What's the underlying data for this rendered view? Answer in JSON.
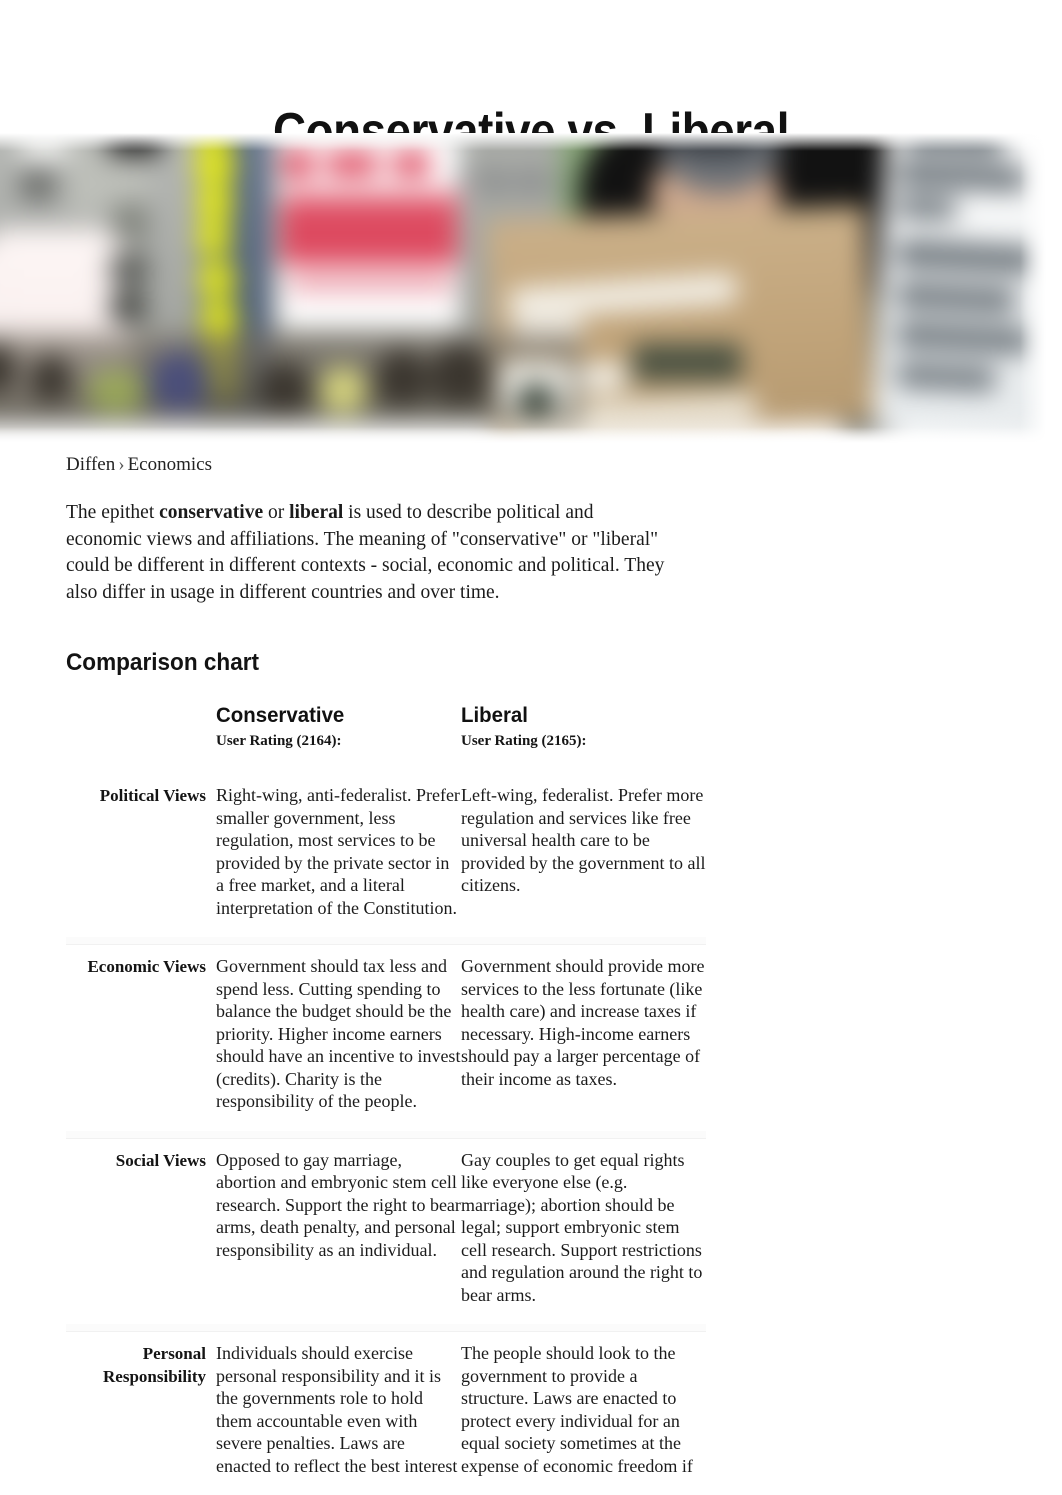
{
  "page": {
    "title": "Conservative vs. Liberal"
  },
  "hero": {
    "alt": "blurred photo of a protest crowd holding signs"
  },
  "breadcrumb": {
    "items": [
      "Diffen",
      "Economics"
    ],
    "separator": "›"
  },
  "intro": {
    "part1": "The epithet ",
    "bold1": "conservative",
    "part2": " or ",
    "bold2": "liberal",
    "part3": " is used to describe political and economic views and affiliations. The meaning of \"conservative\" or \"liberal\" could be different in different contexts - social, economic and political. They also differ in usage in different countries and over time."
  },
  "comparison": {
    "heading": "Comparison chart",
    "columns": [
      {
        "title": "Conservative",
        "rating_label": "User Rating (2164):"
      },
      {
        "title": "Liberal",
        "rating_label": "User Rating (2165):"
      }
    ],
    "rows": [
      {
        "label": "Political Views",
        "conservative": "Right-wing, anti-federalist. Prefer smaller government, less regulation, most services to be provided by the private sector in a free market, and a literal interpretation of the Constitution.",
        "liberal": "Left-wing, federalist. Prefer more regulation and services like free universal health care to be provided by the government to all citizens."
      },
      {
        "label": "Economic Views",
        "conservative": "Government should tax less and spend less. Cutting spending to balance the budget should be the priority. Higher income earners should have an incentive to invest (credits). Charity is the responsibility of the people.",
        "liberal": "Government should provide more services to the less fortunate (like health care) and increase taxes if necessary. High-income earners should pay a larger percentage of their income as taxes."
      },
      {
        "label": "Social Views",
        "conservative": "Opposed to gay marriage, abortion and embryonic stem cell research. Support the right to bear arms, death penalty, and personal responsibility as an individual.",
        "liberal": "Gay couples to get equal rights like everyone else (e.g. marriage); abortion should be legal; support embryonic stem cell research. Support restrictions and regulation around the right to bear arms."
      },
      {
        "label": "Personal Responsibility",
        "conservative": "Individuals should exercise personal responsibility and it is the governments role to hold them accountable even with severe penalties. Laws are enacted to reflect the best interest",
        "liberal": "The people should look to the government to provide a structure. Laws are enacted to protect every individual for an equal society sometimes at the expense of economic freedom if"
      }
    ]
  },
  "colors": {
    "text": "#1b1b1b",
    "heading": "#111111",
    "row_separator": "#fbfbfb",
    "background": "#ffffff"
  }
}
